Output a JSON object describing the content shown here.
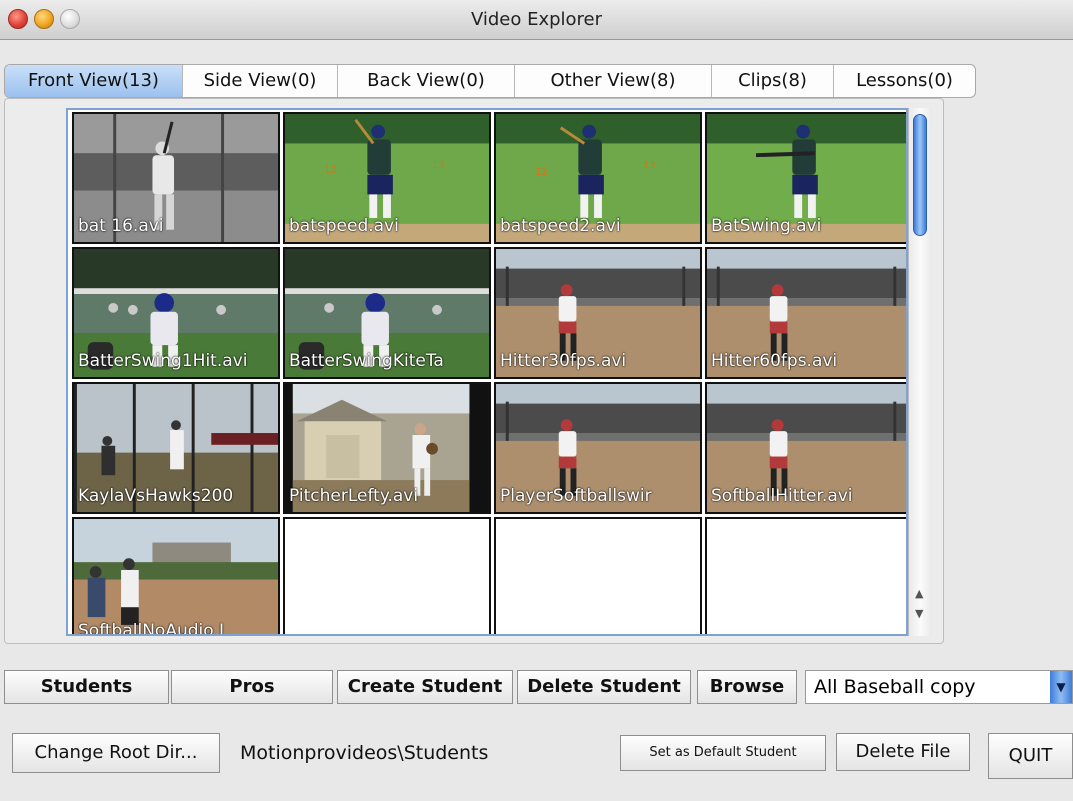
{
  "window": {
    "title": "Video Explorer"
  },
  "tabs": [
    {
      "label": "Front View(13)",
      "active": true
    },
    {
      "label": "Side View(0)",
      "active": false
    },
    {
      "label": "Back View(0)",
      "active": false
    },
    {
      "label": "Other View(8)",
      "active": false
    },
    {
      "label": "Clips(8)",
      "active": false
    },
    {
      "label": "Lessons(0)",
      "active": false
    }
  ],
  "thumbnails": [
    {
      "caption": "bat 16.avi"
    },
    {
      "caption": "batspeed.avi"
    },
    {
      "caption": "batspeed2.avi"
    },
    {
      "caption": "BatSwing.avi"
    },
    {
      "caption": "BatterSwing1Hit.avi"
    },
    {
      "caption": "BatterSwingKiteTa"
    },
    {
      "caption": "Hitter30fps.avi"
    },
    {
      "caption": "Hitter60fps.avi"
    },
    {
      "caption": "KaylaVsHawks200"
    },
    {
      "caption": "PitcherLefty.avi"
    },
    {
      "caption": "PlayerSoftballswir"
    },
    {
      "caption": "SoftballHitter.avi"
    },
    {
      "caption": "SoftballNoAudio I"
    }
  ],
  "buttons": {
    "students": "Students",
    "pros": "Pros",
    "create_student": "Create Student",
    "delete_student": "Delete Student",
    "browse": "Browse",
    "change_root": "Change Root Dir...",
    "set_default": "Set as  Default Student",
    "delete_file": "Delete File",
    "quit": "QUIT"
  },
  "student_select": {
    "value": "All Baseball copy"
  },
  "root_path": "Motionprovideos\\Students",
  "colors": {
    "accent": "#3f7cd9",
    "active_tab": "#9cc1ee"
  }
}
